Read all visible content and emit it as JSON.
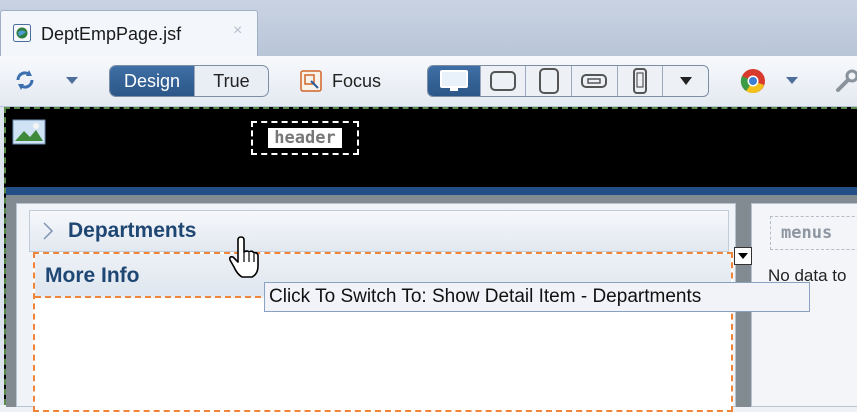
{
  "tab": {
    "title": "DeptEmpPage.jsf",
    "close": "×"
  },
  "toolbar": {
    "design_label": "Design",
    "true_label": "True",
    "focus_label": "Focus"
  },
  "canvas": {
    "header_placeholder": "header",
    "departments_label": "Departments",
    "more_info_label": "More Info",
    "menus_placeholder": "menus",
    "no_data_text": "No data to"
  },
  "tooltip": {
    "text": "Click To Switch To: Show Detail Item - Departments"
  },
  "icons": {
    "tab": "globe-page-icon",
    "sync": "sync-arrows-icon",
    "focus": "focus-icon",
    "desktop": "desktop-monitor-icon",
    "tablet_landscape": "tablet-landscape-icon",
    "tablet_portrait": "tablet-portrait-icon",
    "phone_landscape": "phone-landscape-icon",
    "phone_portrait": "phone-portrait-icon",
    "browser": "chrome-browser-icon",
    "tools": "wrench-icon",
    "image": "image-icon"
  },
  "colors": {
    "accent_blue": "#2b5688",
    "panel_heading": "#1f4773",
    "selection_dash": "#f0853a",
    "page_outline": "#5a8a4a"
  }
}
